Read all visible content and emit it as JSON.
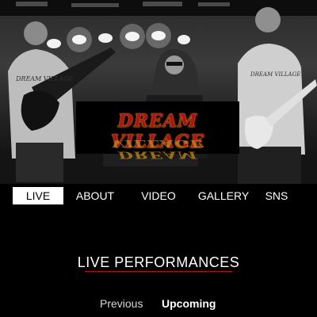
{
  "hero": {
    "logo_text": "DREAM VILLAGE",
    "shirt_text_left": "DREAM VILLAGE",
    "shirt_text_right": "DREAM VILLAGE"
  },
  "nav": {
    "items": [
      {
        "label": "LIVE",
        "active": true
      },
      {
        "label": "ABOUT",
        "active": false
      },
      {
        "label": "VIDEO",
        "active": false
      },
      {
        "label": "GALLERY",
        "active": false
      },
      {
        "label": "SNS",
        "active": false
      }
    ]
  },
  "section": {
    "title": "LIVE PERFORMANCES",
    "accent_color": "#b01212"
  },
  "tabs": {
    "previous": "Previous",
    "upcoming": "Upcoming"
  }
}
